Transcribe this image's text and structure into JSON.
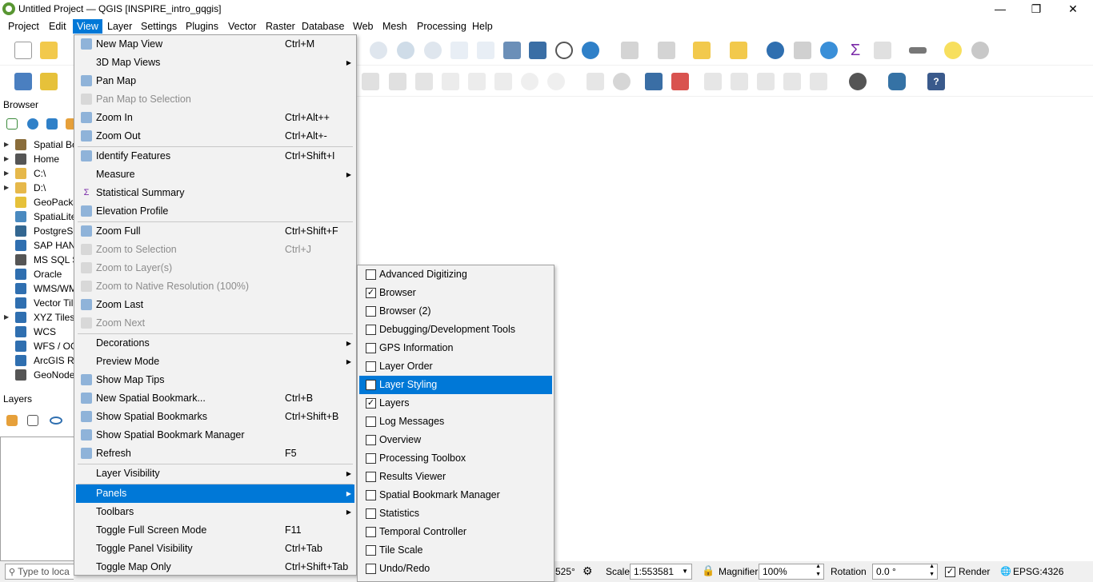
{
  "window": {
    "title": "Untitled Project — QGIS [INSPIRE_intro_gqgis]",
    "controls": [
      "—",
      "❐",
      "✕"
    ]
  },
  "menubar": [
    "Project",
    "Edit",
    "View",
    "Layer",
    "Settings",
    "Plugins",
    "Vector",
    "Raster",
    "Database",
    "Web",
    "Mesh",
    "Processing",
    "Help"
  ],
  "browser": {
    "title": "Browser",
    "items": [
      {
        "label": "Spatial Bo",
        "icon": "bookmark-icon",
        "expandable": true
      },
      {
        "label": "Home",
        "icon": "home-icon",
        "expandable": true
      },
      {
        "label": "C:\\",
        "icon": "folder-icon",
        "expandable": true
      },
      {
        "label": "D:\\",
        "icon": "folder-icon",
        "expandable": true
      },
      {
        "label": "GeoPacka",
        "icon": "geopackage-icon",
        "expandable": false
      },
      {
        "label": "SpatiaLite",
        "icon": "spatialite-icon",
        "expandable": false
      },
      {
        "label": "PostgreSC",
        "icon": "postgres-icon",
        "expandable": false
      },
      {
        "label": "SAP HAN",
        "icon": "saphana-icon",
        "expandable": false
      },
      {
        "label": "MS SQL S",
        "icon": "mssql-icon",
        "expandable": false
      },
      {
        "label": "Oracle",
        "icon": "oracle-icon",
        "expandable": false
      },
      {
        "label": "WMS/WM",
        "icon": "wms-icon",
        "expandable": false
      },
      {
        "label": "Vector Til",
        "icon": "vectortile-icon",
        "expandable": false
      },
      {
        "label": "XYZ Tiles",
        "icon": "xyz-icon",
        "expandable": true
      },
      {
        "label": "WCS",
        "icon": "wcs-icon",
        "expandable": false
      },
      {
        "label": "WFS / OG",
        "icon": "wfs-icon",
        "expandable": false
      },
      {
        "label": "ArcGIS RE",
        "icon": "arcgis-icon",
        "expandable": false
      },
      {
        "label": "GeoNode",
        "icon": "geonode-icon",
        "expandable": false
      }
    ]
  },
  "layers": {
    "title": "Layers"
  },
  "view_menu": {
    "items": [
      {
        "label": "New Map View",
        "shortcut": "Ctrl+M",
        "icon": "new-map-view-icon",
        "y": 0
      },
      {
        "label": "3D Map Views",
        "submenu": true
      },
      {
        "label": "Pan Map",
        "icon": "pan-icon"
      },
      {
        "label": "Pan Map to Selection",
        "disabled": true,
        "icon": "pan-selection-icon"
      },
      {
        "label": "Zoom In",
        "shortcut": "Ctrl+Alt++",
        "icon": "zoom-in-icon"
      },
      {
        "label": "Zoom Out",
        "shortcut": "Ctrl+Alt+-",
        "icon": "zoom-out-icon"
      },
      {
        "sep": true
      },
      {
        "label": "Identify Features",
        "shortcut": "Ctrl+Shift+I",
        "icon": "identify-icon"
      },
      {
        "label": "Measure",
        "submenu": true
      },
      {
        "label": "Statistical Summary",
        "icon": "sigma-icon"
      },
      {
        "label": "Elevation Profile",
        "icon": "elevation-icon"
      },
      {
        "sep": true
      },
      {
        "label": "Zoom Full",
        "shortcut": "Ctrl+Shift+F",
        "icon": "zoom-full-icon"
      },
      {
        "label": "Zoom to Selection",
        "shortcut": "Ctrl+J",
        "disabled": true,
        "icon": "zoom-selection-icon"
      },
      {
        "label": "Zoom to Layer(s)",
        "disabled": true,
        "icon": "zoom-layer-icon"
      },
      {
        "label": "Zoom to Native Resolution (100%)",
        "disabled": true,
        "icon": "zoom-native-icon"
      },
      {
        "label": "Zoom Last",
        "icon": "zoom-last-icon"
      },
      {
        "label": "Zoom Next",
        "disabled": true,
        "icon": "zoom-next-icon"
      },
      {
        "sep": true
      },
      {
        "label": "Decorations",
        "submenu": true
      },
      {
        "label": "Preview Mode",
        "submenu": true
      },
      {
        "label": "Show Map Tips",
        "icon": "map-tips-icon"
      },
      {
        "label": "New Spatial Bookmark...",
        "shortcut": "Ctrl+B",
        "icon": "new-bookmark-icon"
      },
      {
        "label": "Show Spatial Bookmarks",
        "shortcut": "Ctrl+Shift+B",
        "icon": "bookmarks-icon"
      },
      {
        "label": "Show Spatial Bookmark Manager",
        "icon": "bookmark-manager-icon"
      },
      {
        "label": "Refresh",
        "shortcut": "F5",
        "icon": "refresh-icon"
      },
      {
        "sep": true
      },
      {
        "label": "Layer Visibility",
        "submenu": true
      },
      {
        "sep": true
      },
      {
        "label": "Panels",
        "submenu": true,
        "highlight": true
      },
      {
        "label": "Toolbars",
        "submenu": true
      },
      {
        "label": "Toggle Full Screen Mode",
        "shortcut": "F11"
      },
      {
        "label": "Toggle Panel Visibility",
        "shortcut": "Ctrl+Tab"
      },
      {
        "label": "Toggle Map Only",
        "shortcut": "Ctrl+Shift+Tab"
      }
    ]
  },
  "panels_menu": {
    "items": [
      {
        "label": "Advanced Digitizing",
        "checked": false
      },
      {
        "label": "Browser",
        "checked": true
      },
      {
        "label": "Browser (2)",
        "checked": false
      },
      {
        "label": "Debugging/Development Tools",
        "checked": false
      },
      {
        "label": "GPS Information",
        "checked": false
      },
      {
        "label": "Layer Order",
        "checked": false
      },
      {
        "label": "Layer Styling",
        "checked": false,
        "highlight": true
      },
      {
        "label": "Layers",
        "checked": true
      },
      {
        "label": "Log Messages",
        "checked": false
      },
      {
        "label": "Overview",
        "checked": false
      },
      {
        "label": "Processing Toolbox",
        "checked": false
      },
      {
        "label": "Results Viewer",
        "checked": false
      },
      {
        "label": "Spatial Bookmark Manager",
        "checked": false
      },
      {
        "label": "Statistics",
        "checked": false
      },
      {
        "label": "Temporal Controller",
        "checked": false
      },
      {
        "label": "Tile Scale",
        "checked": false
      },
      {
        "label": "Undo/Redo",
        "checked": false
      }
    ]
  },
  "statusbar": {
    "locator_placeholder": "Type to loca",
    "coordinate_tail": "525°",
    "scale_label": "Scale",
    "scale_value": "1:553581",
    "magnifier_label": "Magnifier",
    "magnifier_value": "100%",
    "rotation_label": "Rotation",
    "rotation_value": "0.0 °",
    "render_label": "Render",
    "crs": "EPSG:4326"
  },
  "colors": {
    "accent": "#0078d7",
    "menu_bg": "#f2f2f2",
    "qgis_green": "#589632"
  }
}
